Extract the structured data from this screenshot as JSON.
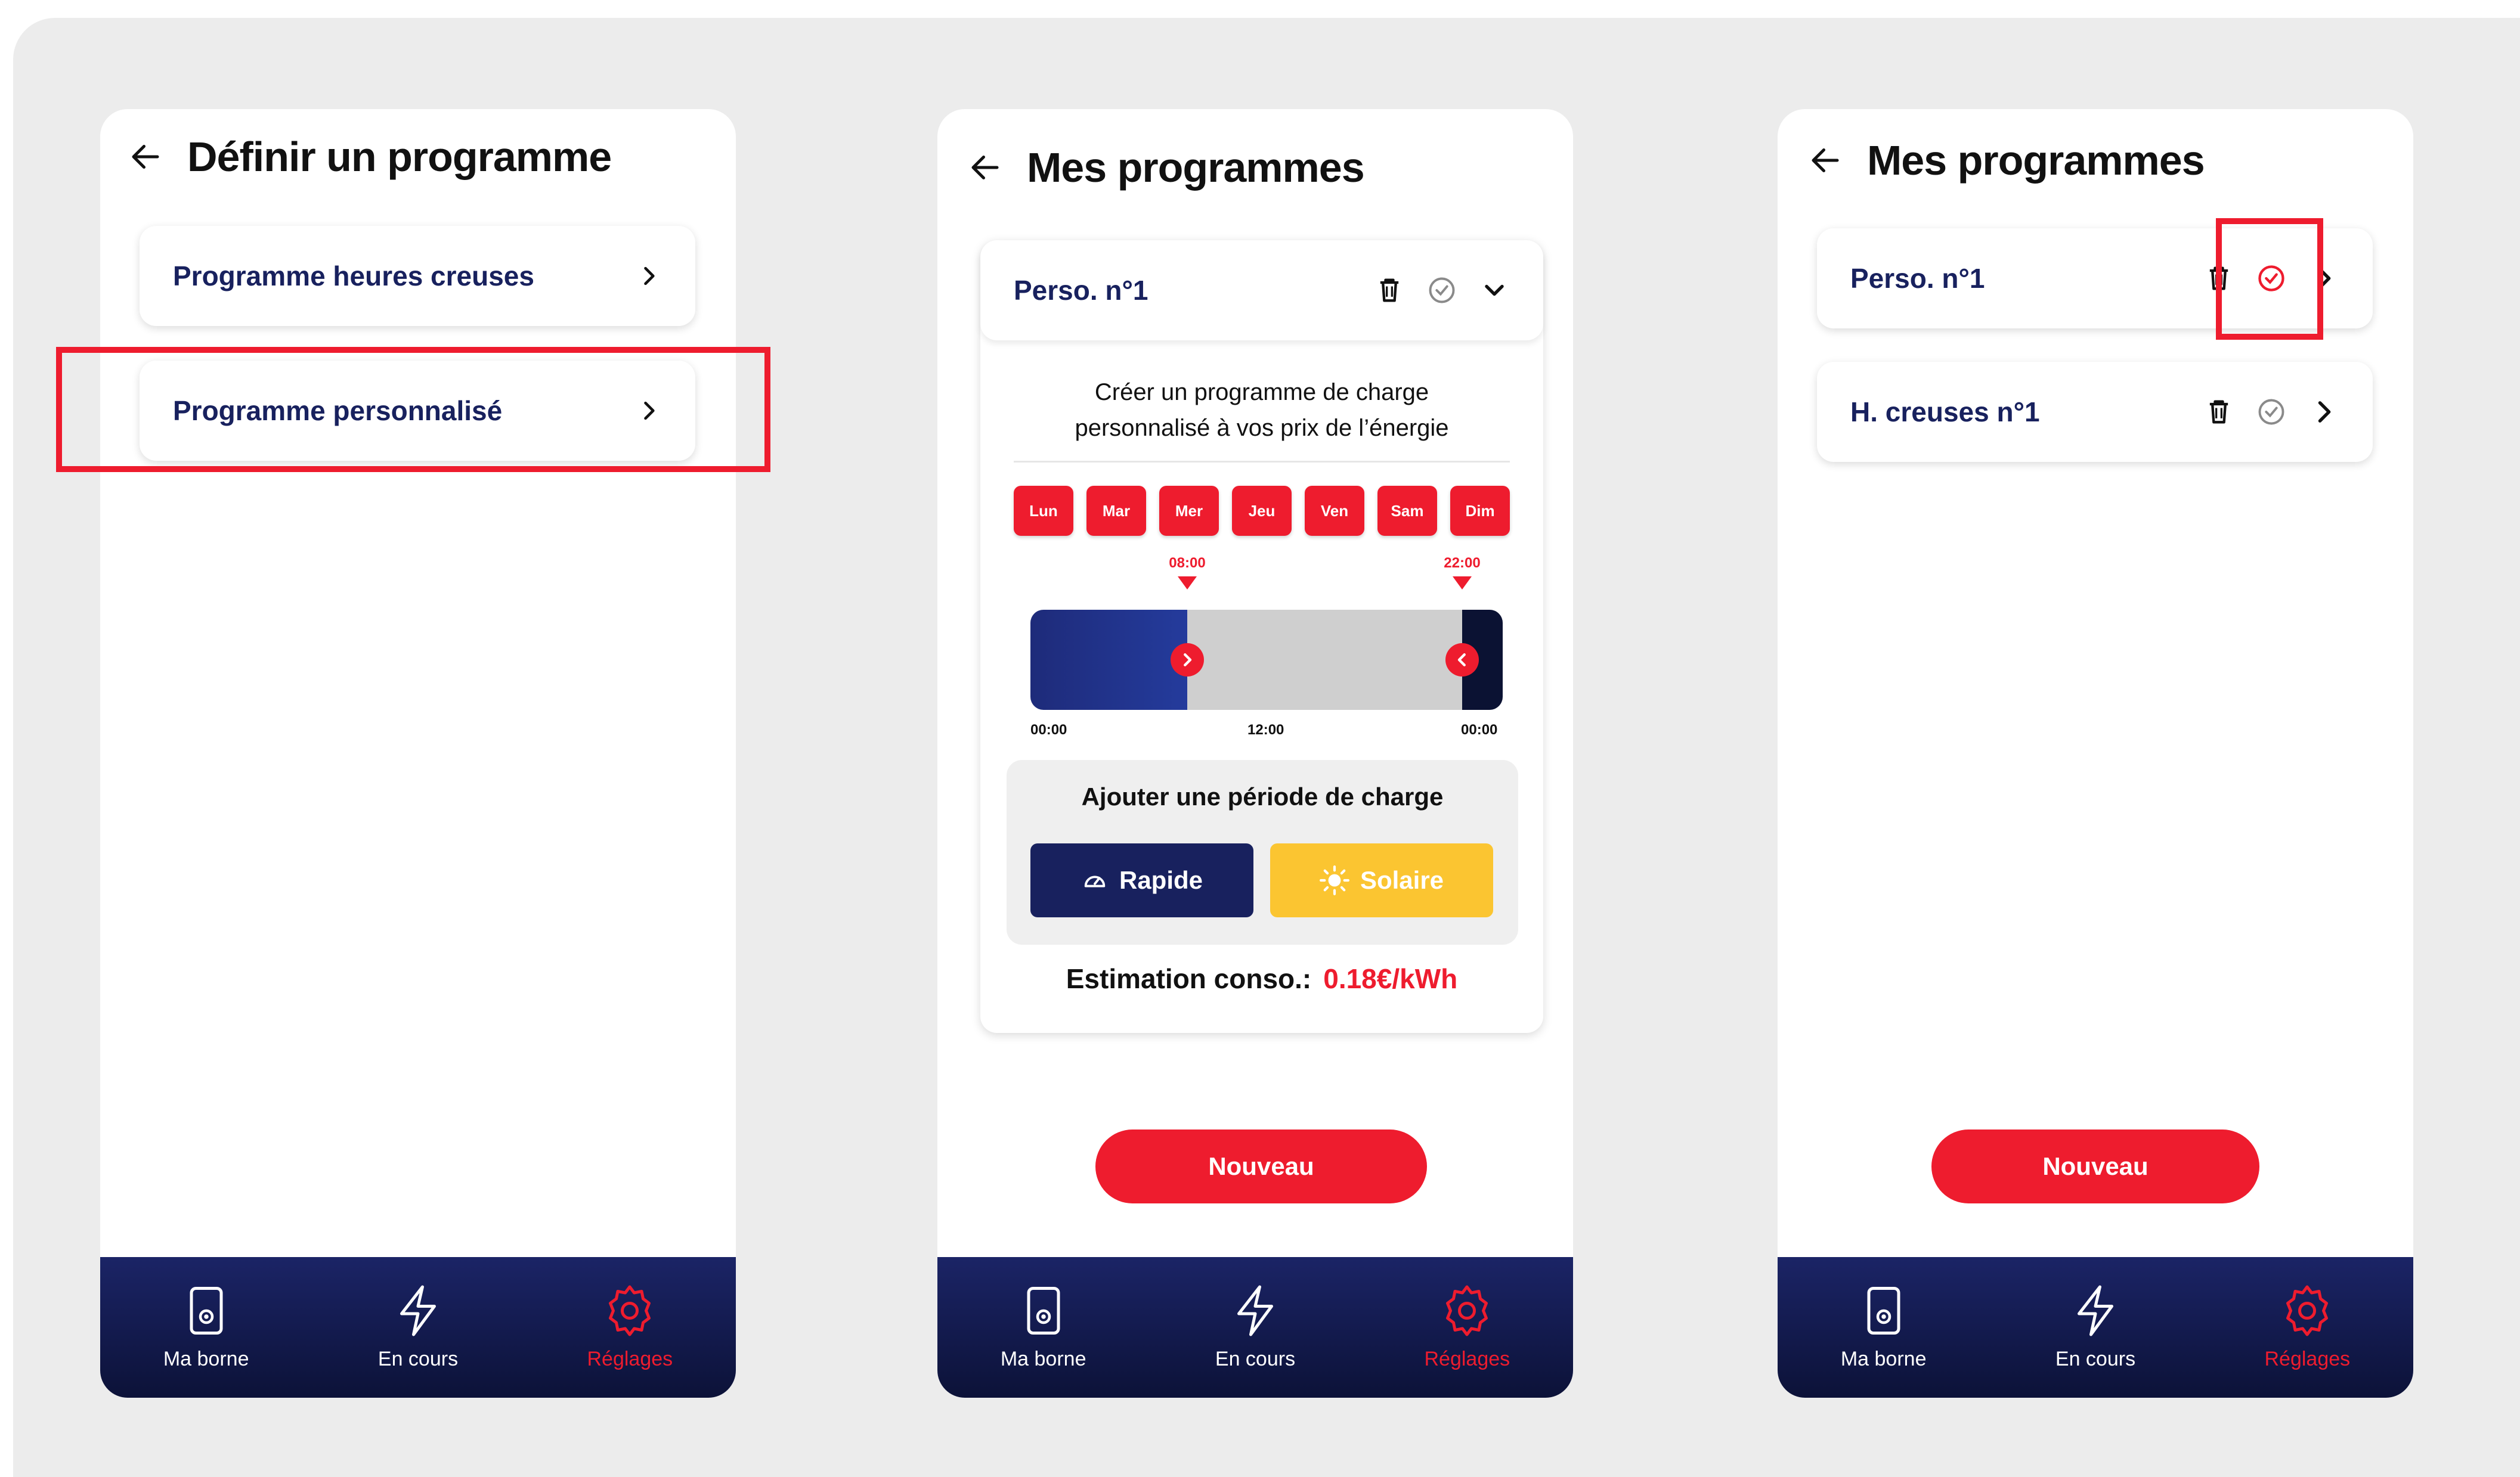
{
  "screen1": {
    "title": "Définir un programme",
    "items": [
      {
        "label": "Programme heures creuses"
      },
      {
        "label": "Programme personnalisé"
      }
    ]
  },
  "screen2": {
    "title": "Mes programmes",
    "program": {
      "name": "Perso. n°1",
      "description_line1": "Créer un programme de charge",
      "description_line2": "personnalisé à vos prix de l’énergie",
      "days": [
        "Lun",
        "Mar",
        "Mer",
        "Jeu",
        "Ven",
        "Sam",
        "Dim"
      ],
      "start_marker": "08:00",
      "end_marker": "22:00",
      "ticks": [
        "00:00",
        "12:00",
        "00:00"
      ],
      "add_period_title": "Ajouter une période de charge",
      "rapide_label": "Rapide",
      "solaire_label": "Solaire",
      "estimation_label": "Estimation conso.:",
      "estimation_value": "0.18€/kWh"
    },
    "new_button": "Nouveau"
  },
  "screen3": {
    "title": "Mes programmes",
    "programs": [
      {
        "name": "Perso. n°1",
        "active": true
      },
      {
        "name": "H. creuses n°1",
        "active": false
      }
    ],
    "new_button": "Nouveau"
  },
  "nav": {
    "items": [
      {
        "label": "Ma borne",
        "icon": "charger-icon"
      },
      {
        "label": "En cours",
        "icon": "lightning-icon"
      },
      {
        "label": "Réglages",
        "icon": "gear-icon",
        "active": true
      }
    ]
  },
  "colors": {
    "accent_red": "#ee1c2e",
    "navy": "#18215e",
    "solar_yellow": "#fbc531",
    "background": "#ececec"
  }
}
